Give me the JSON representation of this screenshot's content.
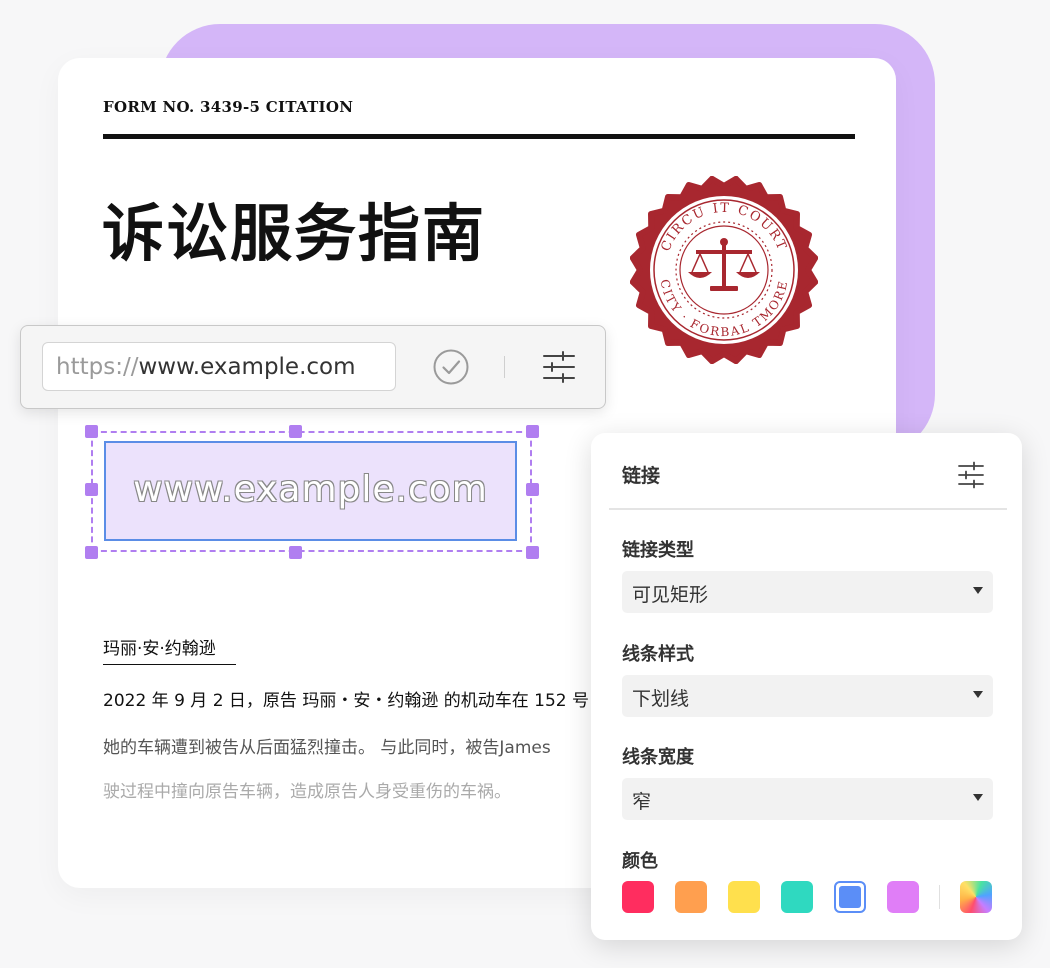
{
  "document": {
    "form_number": "FORM NO. 3439-5 CITATION",
    "title": "诉讼服务指南",
    "seal_text": "CIRCUIT COURT · FORBAL TMORE CITY",
    "plaintiff_name": "玛丽·安·约翰逊",
    "paragraphs": [
      "2022 年 9 月 2 日，原告 玛丽・安・约翰逊 的机动车在 152 号",
      "她的车辆遭到被告从后面猛烈撞击。 与此同时，被告James",
      "驶过程中撞向原告车辆，造成原告人身受重伤的车祸。"
    ],
    "link_annotation_text": "www.example.com"
  },
  "url_bar": {
    "prefix": "https://",
    "value": "www.example.com"
  },
  "link_panel": {
    "title": "链接",
    "link_type_label": "链接类型",
    "link_type_value": "可见矩形",
    "line_style_label": "线条样式",
    "line_style_value": "下划线",
    "line_width_label": "线条宽度",
    "line_width_value": "窄",
    "color_label": "颜色",
    "colors": [
      "#ff2d5f",
      "#ff9f4f",
      "#ffe04d",
      "#2fd9c0",
      "#5b8ef7",
      "#e07ef7"
    ],
    "selected_color": "#5b8ef7"
  },
  "icons": {
    "confirm": "check-circle-icon",
    "settings": "sliders-icon",
    "seal_center": "scales-of-justice-icon",
    "custom_color": "rainbow-color-picker-icon"
  },
  "theme": {
    "accent_purple": "#d4b6f8",
    "selection_purple": "#b07ef0",
    "seal_red": "#a8272f",
    "link_border_blue": "#5b8de6"
  }
}
